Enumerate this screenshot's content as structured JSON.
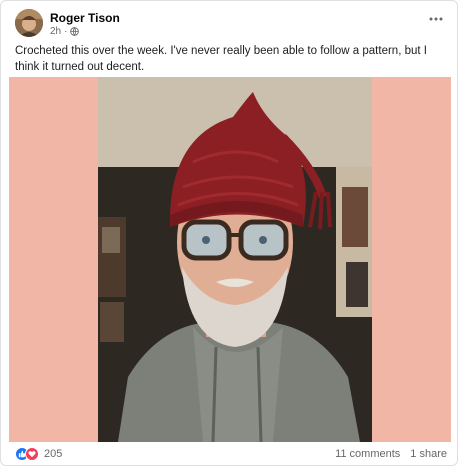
{
  "post": {
    "author": "Roger Tison",
    "time": "2h",
    "privacy_icon": "globe-icon",
    "caption": "Crocheted this over the week. I've never really been able to follow a pattern, but I think it turned out decent.",
    "more_icon": "more-dots-icon"
  },
  "footer": {
    "reaction_icons": [
      "like-icon",
      "love-icon"
    ],
    "reaction_count": "205",
    "comments": "11 comments",
    "shares": "1 share"
  },
  "colors": {
    "photo_side_background": "#f1b6a5",
    "like_blue": "#1877f2",
    "love_red": "#f33e58",
    "hat_red": "#8c1f24"
  }
}
